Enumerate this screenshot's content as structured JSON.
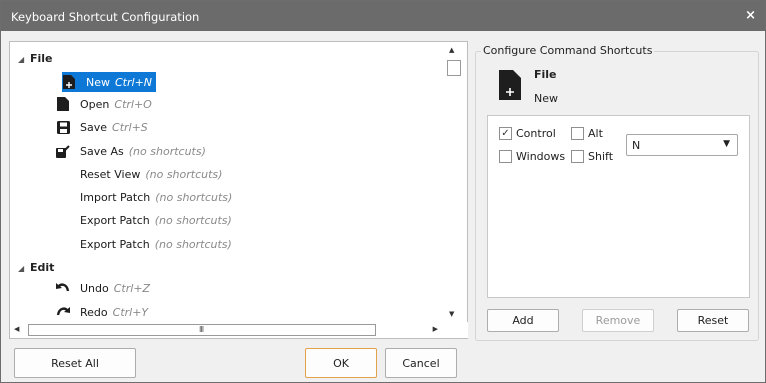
{
  "window": {
    "title": "Keyboard Shortcut Configuration",
    "close_glyph": "×"
  },
  "tree": {
    "categories": [
      {
        "name": "File",
        "items": [
          {
            "label": "New",
            "shortcut": "Ctrl+N",
            "icon": "new-file-icon",
            "selected": true
          },
          {
            "label": "Open",
            "shortcut": "Ctrl+O",
            "icon": "open-file-icon"
          },
          {
            "label": "Save",
            "shortcut": "Ctrl+S",
            "icon": "save-icon"
          },
          {
            "label": "Save As",
            "shortcut": "(no shortcuts)",
            "icon": "save-as-icon"
          },
          {
            "label": "Reset View",
            "shortcut": "(no shortcuts)",
            "icon": ""
          },
          {
            "label": "Import Patch",
            "shortcut": "(no shortcuts)",
            "icon": ""
          },
          {
            "label": "Export Patch",
            "shortcut": "(no shortcuts)",
            "icon": ""
          },
          {
            "label": "Export Patch",
            "shortcut": "(no shortcuts)",
            "icon": ""
          }
        ]
      },
      {
        "name": "Edit",
        "items": [
          {
            "label": "Undo",
            "shortcut": "Ctrl+Z",
            "icon": "undo-icon"
          },
          {
            "label": "Redo",
            "shortcut": "Ctrl+Y",
            "icon": "redo-icon"
          }
        ]
      }
    ],
    "scroll_grip": "III"
  },
  "config": {
    "legend": "Configure Command Shortcuts",
    "category": "File",
    "command": "New",
    "modifiers": {
      "control": {
        "label": "Control",
        "checked": true
      },
      "alt": {
        "label": "Alt",
        "checked": false
      },
      "windows": {
        "label": "Windows",
        "checked": false
      },
      "shift": {
        "label": "Shift",
        "checked": false
      }
    },
    "key": "N",
    "add_label": "Add",
    "remove_label": "Remove",
    "reset_label": "Reset"
  },
  "footer": {
    "reset_all_label": "Reset All",
    "ok_label": "OK",
    "cancel_label": "Cancel"
  }
}
